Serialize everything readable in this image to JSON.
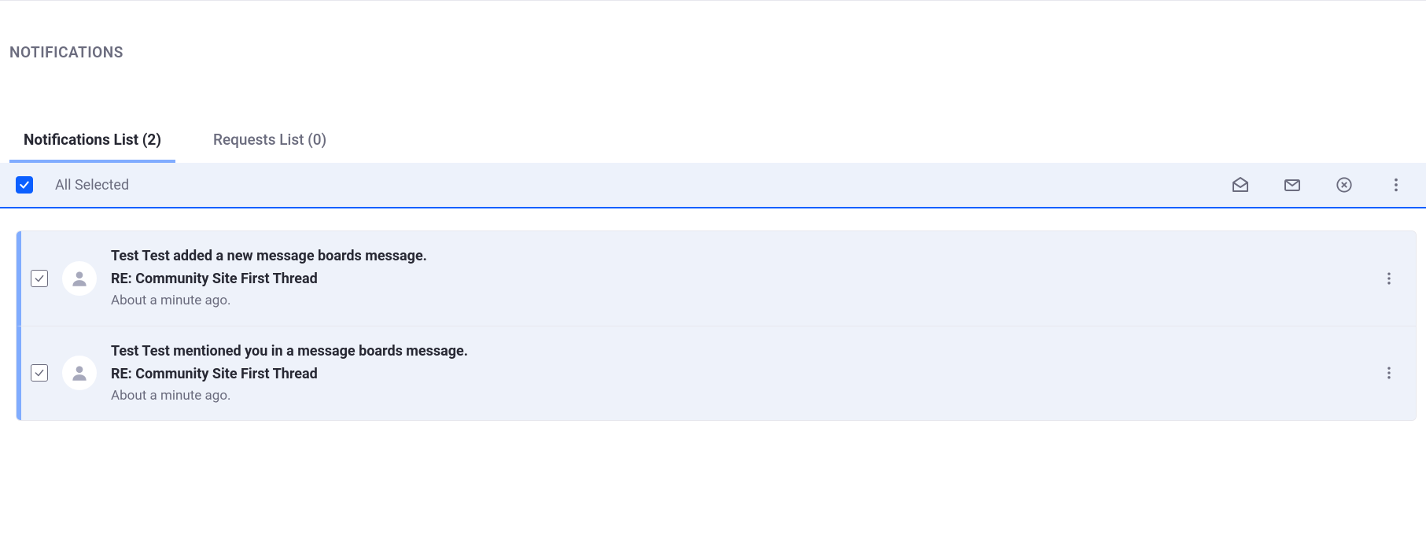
{
  "header": {
    "title": "NOTIFICATIONS"
  },
  "tabs": {
    "notifications": {
      "label": "Notifications List (2)"
    },
    "requests": {
      "label": "Requests List (0)"
    }
  },
  "toolbar": {
    "select_label": "All Selected"
  },
  "notifications": [
    {
      "title": "Test Test added a new message boards message.",
      "subject": "RE: Community Site First Thread",
      "time": "About a minute ago."
    },
    {
      "title": "Test Test mentioned you in a message boards message.",
      "subject": "RE: Community Site First Thread",
      "time": "About a minute ago."
    }
  ]
}
